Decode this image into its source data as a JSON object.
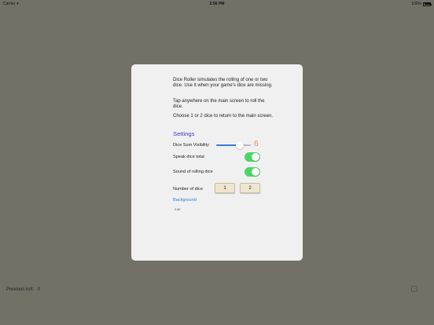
{
  "status_bar": {
    "carrier": "Carrier",
    "wifi_icon": "wifi-icon",
    "time": "2:56 PM",
    "battery_text": "100%",
    "battery_level": 1.0
  },
  "panel": {
    "info_1": "Dice Roller simulates the rolling of one or two dice. Use it when your game's dice are missing.",
    "info_2": "Tap anywhere on the main screen to roll the dice.",
    "info_3": "Choose 1 or 2 dice to return to the main screen.",
    "settings_title": "Settings",
    "dice_sum_visibility": {
      "label": "Dice Sum Visibility",
      "slider_fraction": 0.68,
      "value": "6",
      "accent": "#f08a5d"
    },
    "speak_dice_total": {
      "label": "Speak dice total",
      "on": true
    },
    "sound_of_rolling_dice": {
      "label": "Sound of rolling dice",
      "on": true
    },
    "number_of_dice": {
      "label": "Number of dice",
      "buttons": [
        "1",
        "2"
      ]
    },
    "background": {
      "label": "Background",
      "value": "2.40"
    }
  },
  "footer": {
    "previous_roll_label": "Previous roll:",
    "previous_roll_value": "0",
    "info_icon": "info-icon"
  },
  "colors": {
    "background": "#737166",
    "panel": "#f0f0f0",
    "toggle_on": "#4bd663",
    "link": "#2f7ad6",
    "section_title": "#3a3fc0"
  }
}
